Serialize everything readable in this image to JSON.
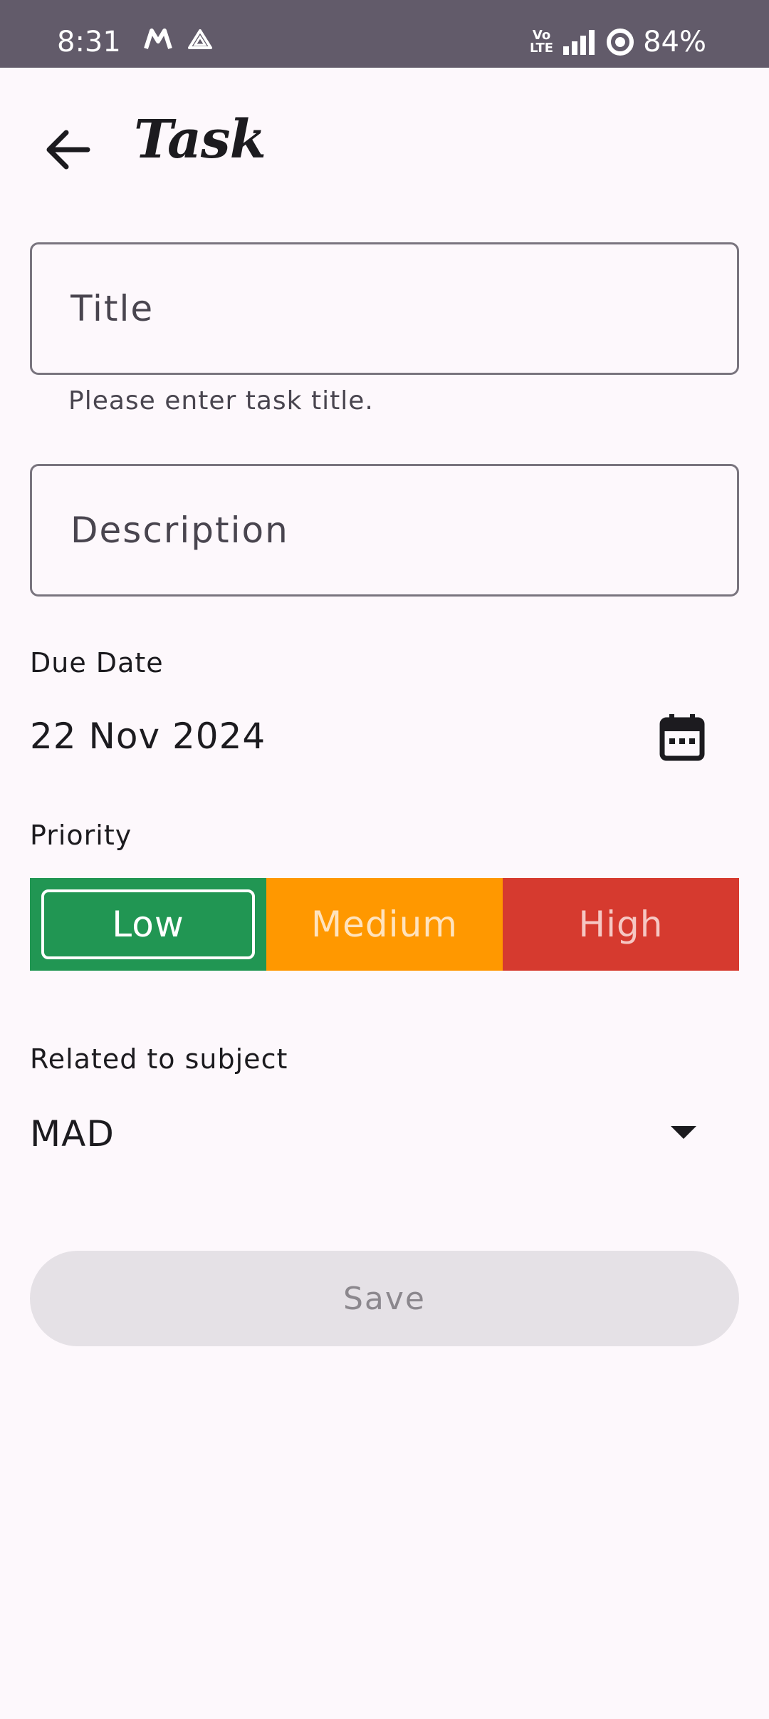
{
  "status_bar": {
    "time": "8:31",
    "network": "Vo LTE",
    "battery": "84%",
    "icons": [
      "m-app-icon",
      "drive-icon",
      "volte-icon",
      "signal-icon",
      "battery-ring-icon"
    ]
  },
  "header": {
    "title": "Task",
    "back_icon": "arrow-back-icon"
  },
  "form": {
    "title_field": {
      "placeholder": "Title",
      "value": "",
      "helper": "Please enter task title."
    },
    "description_field": {
      "placeholder": "Description",
      "value": ""
    },
    "due_date": {
      "label": "Due Date",
      "value": "22 Nov 2024",
      "icon": "calendar-icon"
    },
    "priority": {
      "label": "Priority",
      "options": [
        {
          "label": "Low",
          "color": "#219653",
          "selected": true
        },
        {
          "label": "Medium",
          "color": "#ff9800",
          "selected": false
        },
        {
          "label": "High",
          "color": "#d63a2f",
          "selected": false
        }
      ]
    },
    "subject": {
      "label": "Related to subject",
      "value": "MAD",
      "icon": "dropdown-arrow-icon"
    },
    "save_label": "Save"
  },
  "colors": {
    "status_bar": "#625b6a",
    "background": "#fdf8fc",
    "save_disabled": "#e5e1e6"
  }
}
